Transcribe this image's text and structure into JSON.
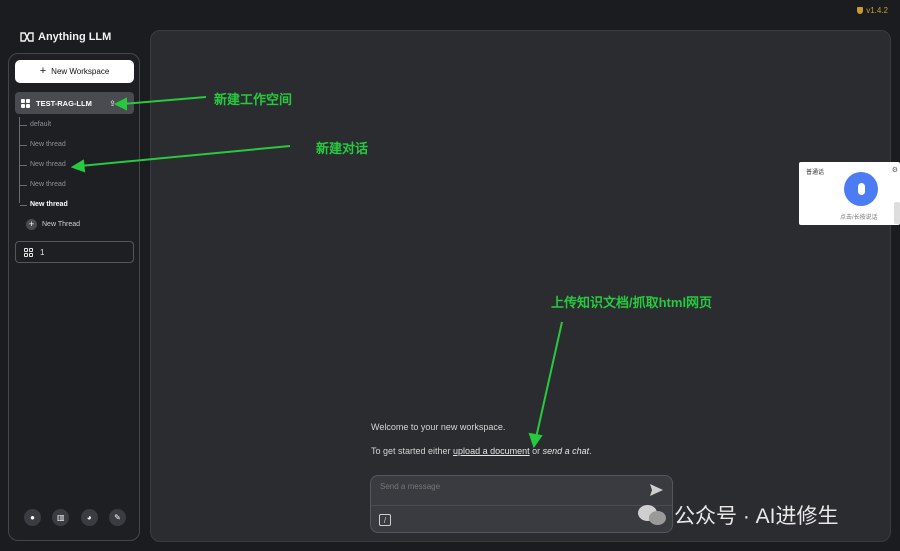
{
  "app": {
    "name": "Anything LLM",
    "version": "v1.4.2",
    "accent_color": "#c99a2e"
  },
  "sidebar": {
    "new_workspace_label": "New Workspace",
    "active_workspace": "TEST-RAG-LLM",
    "threads": [
      {
        "label": "default",
        "active": false
      },
      {
        "label": "New thread",
        "active": false
      },
      {
        "label": "New thread",
        "active": false
      },
      {
        "label": "New thread",
        "active": false
      },
      {
        "label": "New thread",
        "active": true
      }
    ],
    "new_thread_label": "New Thread",
    "other_workspace": "1",
    "footer_icons": [
      "github-icon",
      "book-icon",
      "discord-icon",
      "wrench-icon"
    ]
  },
  "main": {
    "welcome": "Welcome to your new workspace.",
    "get_started_prefix": "To get started either ",
    "upload_link": "upload a document",
    "or_text": " or ",
    "send_chat": "send a chat",
    "period": ".",
    "composer_placeholder": "Send a message"
  },
  "annotations": {
    "new_workspace": "新建工作空间",
    "new_dialog": "新建对话",
    "upload": "上传知识文档/抓取html网页",
    "color": "#27c93f"
  },
  "voice_widget": {
    "label": "普通话",
    "hint": "点击/长按说话"
  },
  "watermark": {
    "text": "公众号 · AI进修生"
  }
}
